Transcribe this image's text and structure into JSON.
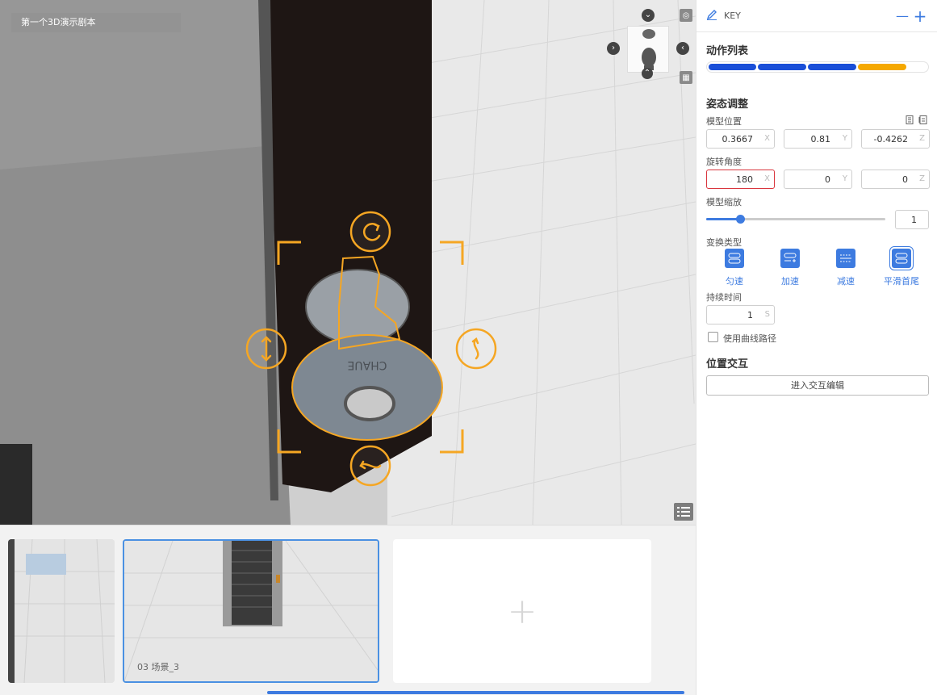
{
  "viewport": {
    "doc_title": "第一个3D演示剧本",
    "key_text": "CHAUE"
  },
  "filmstrip": {
    "scenes": [
      {
        "label": ""
      },
      {
        "label": "03   场景_3",
        "active": true
      },
      {
        "label": ""
      }
    ],
    "add_symbol": "+"
  },
  "panel": {
    "header": {
      "title": "KEY",
      "minus": "—",
      "plus": "+"
    },
    "actions": {
      "title": "动作列表",
      "segments": [
        {
          "color": "#1a4fd8"
        },
        {
          "color": "#1a4fd8"
        },
        {
          "color": "#1a4fd8"
        },
        {
          "color": "#f5a800"
        }
      ]
    },
    "pose": {
      "title": "姿态调整",
      "position": {
        "label": "模型位置",
        "x": "0.3667",
        "y": "0.81",
        "z": "-0.4262"
      },
      "rotation": {
        "label": "旋转角度",
        "x": "180",
        "y": "0",
        "z": "0"
      },
      "scale": {
        "label": "模型缩放",
        "value": "1",
        "slider_fraction": 0.19
      },
      "axes": {
        "x": "X",
        "y": "Y",
        "z": "Z"
      },
      "easing": {
        "label": "变换类型",
        "options": [
          "匀速",
          "加速",
          "减速",
          "平滑首尾"
        ],
        "selected": "平滑首尾"
      },
      "duration": {
        "label": "持续时间",
        "value": "1",
        "unit": "S"
      },
      "curve_path": {
        "label": "使用曲线路径",
        "checked": false
      }
    },
    "interaction": {
      "title": "位置交互",
      "button": "进入交互编辑"
    }
  }
}
